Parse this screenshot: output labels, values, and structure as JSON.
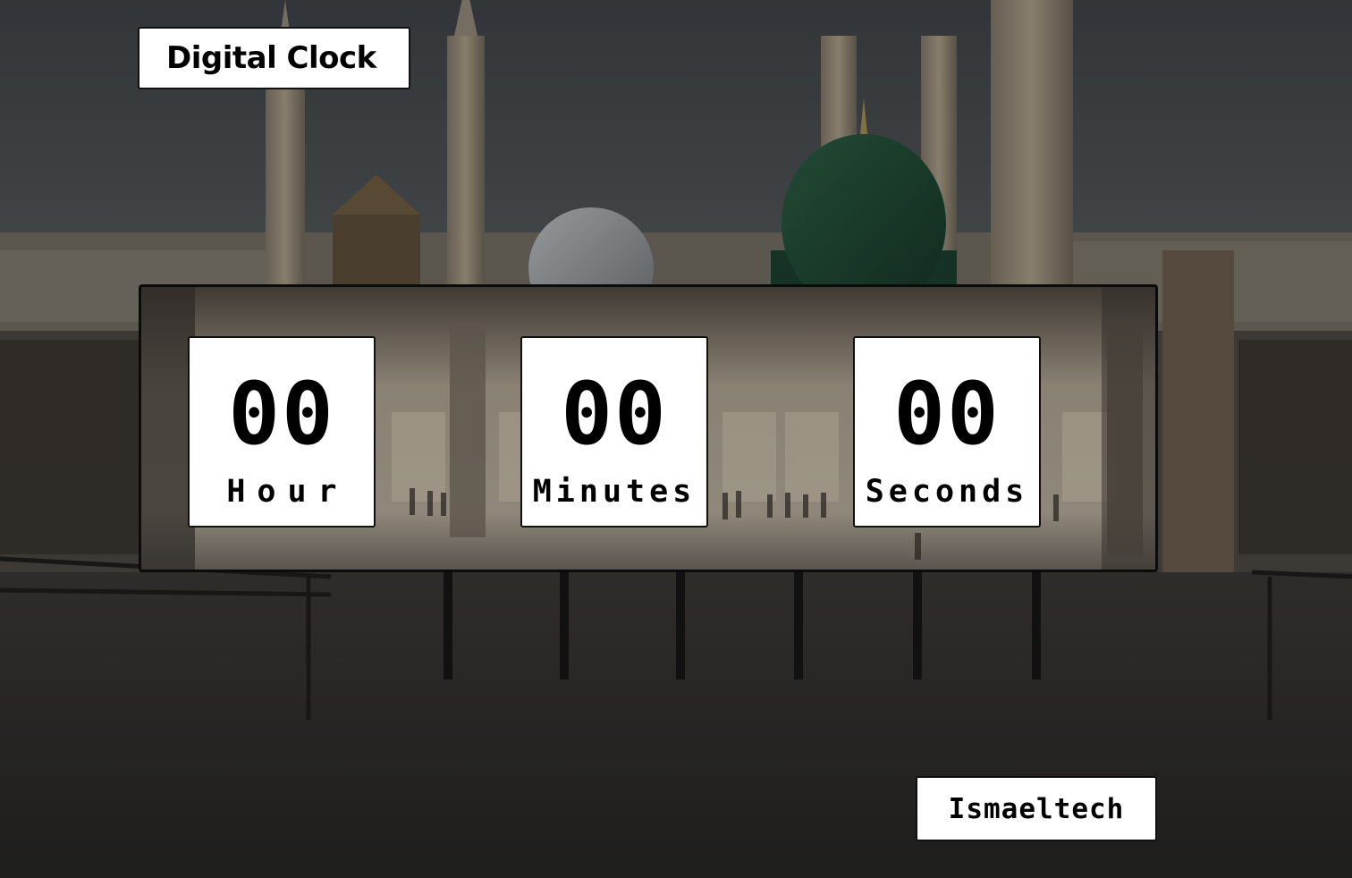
{
  "page": {
    "title": "Digital Clock",
    "credit": "Ismaeltech"
  },
  "clock": {
    "hour": {
      "value": "00",
      "label": "Hour"
    },
    "minutes": {
      "value": "00",
      "label": "Minutes"
    },
    "seconds": {
      "value": "00",
      "label": "Seconds"
    }
  },
  "background": {
    "description_icon": "mosque-photo",
    "dome_color": "#1f4a34",
    "sky_color": "#43484c",
    "floor_color": "#2e2d2c"
  }
}
